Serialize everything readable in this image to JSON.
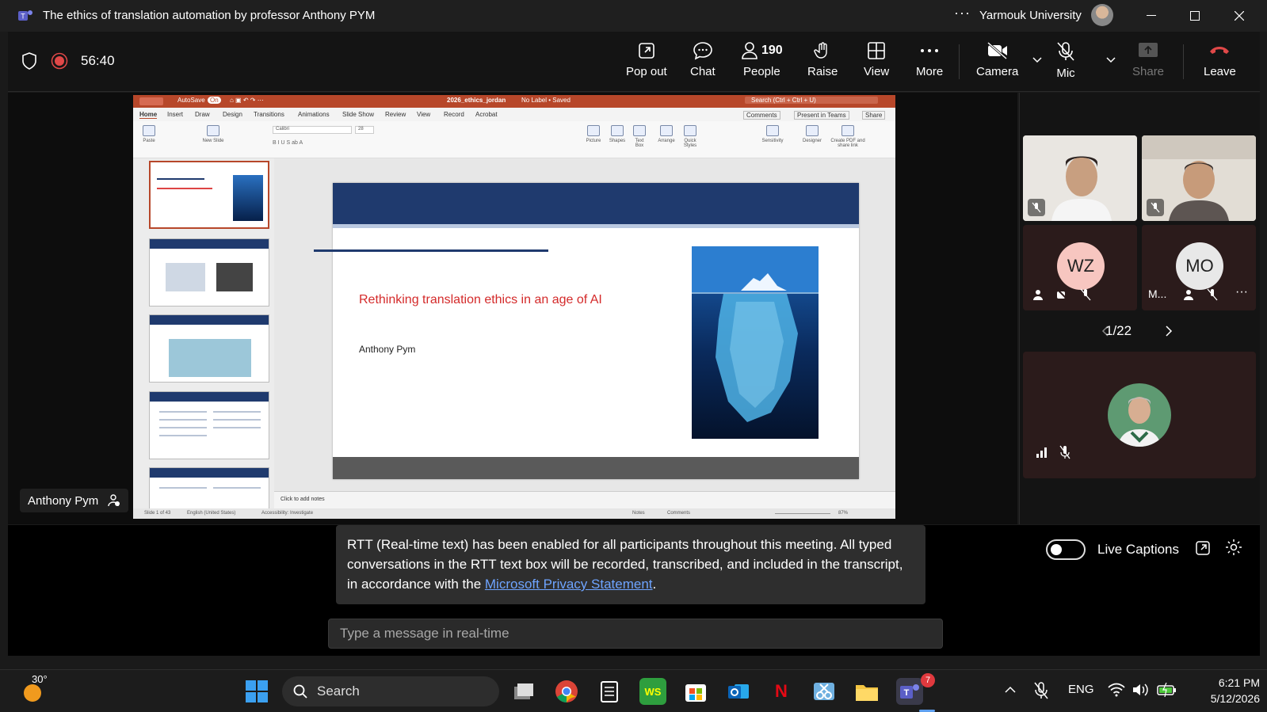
{
  "titlebar": {
    "title": "The ethics of translation automation by professor Anthony PYM",
    "org": "Yarmouk University"
  },
  "toolbar": {
    "timer": "56:40",
    "pop_out": "Pop out",
    "chat": "Chat",
    "people_count": "190",
    "people": "People",
    "raise": "Raise",
    "view": "View",
    "more": "More",
    "camera": "Camera",
    "mic": "Mic",
    "share": "Share",
    "leave": "Leave"
  },
  "ppt": {
    "autosave": "AutoSave",
    "autosave_state": "On",
    "filename": "2026_ethics_jordan",
    "label_status": "No Label • Saved",
    "search": "Search (Ctrl + Ctrl + U)",
    "menu": [
      "Home",
      "Insert",
      "Draw",
      "Design",
      "Transitions",
      "Animations",
      "Slide Show",
      "Review",
      "View",
      "Record",
      "Acrobat"
    ],
    "comments": "Comments",
    "present_in_teams": "Present in Teams",
    "share": "Share",
    "ribbon": [
      "Paste",
      "New Slide",
      "Picture",
      "Shapes",
      "Text Box",
      "Arrange",
      "Quick Styles",
      "Sensitivity",
      "Designer",
      "Create PDF and share link"
    ],
    "font": "Calibri",
    "font_size": "28",
    "slide_nums": [
      "1",
      "2",
      "3",
      "4",
      "5"
    ],
    "slide_title": "Rethinking translation ethics in an age of AI",
    "slide_author": "Anthony Pym",
    "notes_placeholder": "Click to add notes",
    "status_slide": "Slide 1 of 43",
    "status_lang": "English (United States)",
    "status_access": "Accessibility: Investigate",
    "status_notes": "Notes",
    "status_comments": "Comments",
    "zoom": "87%"
  },
  "speaker": {
    "name": "Anthony Pym"
  },
  "participants": {
    "tile3_initials": "WZ",
    "tile4_initials": "MO",
    "tile4_name": "M...",
    "page": "1/22"
  },
  "captions": {
    "rtt_text": "RTT (Real-time text) has been enabled for all participants throughout this meeting. All typed conversations in the RTT text box will be recorded, transcribed, and included in the transcript, in accordance with the ",
    "rtt_link": "Microsoft Privacy Statement",
    "rtt_end": ".",
    "input_placeholder": "Type a message in real-time",
    "live_captions": "Live Captions"
  },
  "taskbar": {
    "weather": "30°",
    "search": "Search",
    "teams_badge": "7",
    "lang": "ENG",
    "time": "6:21 PM",
    "date": "5/12/2026"
  },
  "colors": {
    "accent_red": "#c4314b",
    "ppt_red": "#b7472a",
    "slide_navy": "#1f3a6e",
    "slide_title_red": "#d42a2a",
    "link_blue": "#6ea4ff"
  }
}
